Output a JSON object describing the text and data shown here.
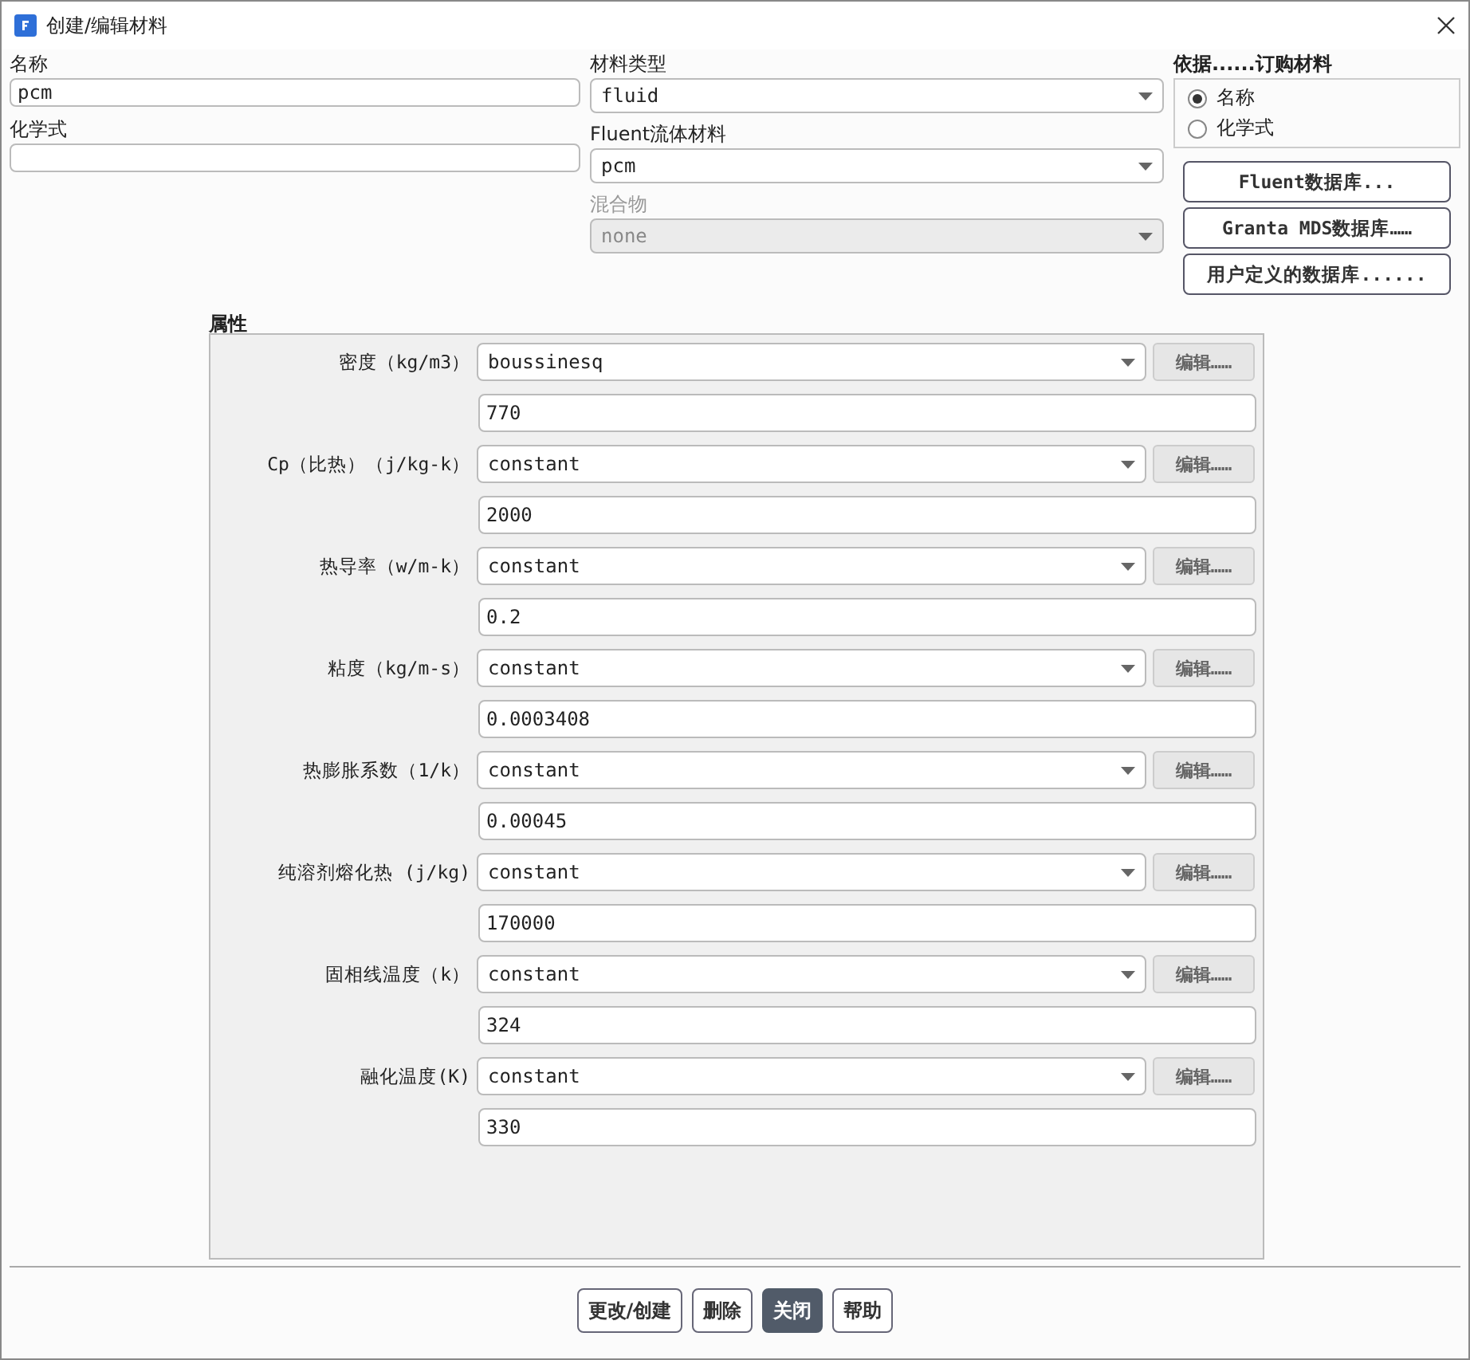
{
  "window": {
    "title": "创建/编辑材料"
  },
  "name": {
    "label": "名称",
    "value": "pcm"
  },
  "formula": {
    "label": "化学式"
  },
  "material_type": {
    "label": "材料类型",
    "value": "fluid",
    "disabled": false
  },
  "fluent_material": {
    "label": "Fluent流体材料",
    "value": "pcm",
    "disabled": false
  },
  "mixture": {
    "label": "混合物",
    "value": "none",
    "disabled": true
  },
  "order_by": {
    "label": "依据......订购材料",
    "options": [
      {
        "label": "名称",
        "selected": true
      },
      {
        "label": "化学式",
        "selected": false
      }
    ]
  },
  "database_buttons": [
    "Fluent数据库...",
    "Granta MDS数据库……",
    "用户定义的数据库......"
  ],
  "properties": {
    "title": "属性",
    "rows": [
      {
        "label": "密度（kg/m3）",
        "method": "boussinesq",
        "value": "770",
        "edit": "编辑……",
        "edit_disabled": true
      },
      {
        "label": "Cp（比热）（j/kg-k）",
        "method": "constant",
        "value": "2000",
        "edit": "编辑……",
        "edit_disabled": true
      },
      {
        "label": "热导率（w/m-k）",
        "method": "constant",
        "value": "0.2",
        "edit": "编辑……",
        "edit_disabled": true
      },
      {
        "label": "粘度（kg/m-s）",
        "method": "constant",
        "value": "0.0003408",
        "edit": "编辑……",
        "edit_disabled": true
      },
      {
        "label": "热膨胀系数（1/k）",
        "method": "constant",
        "value": "0.00045",
        "edit": "编辑……",
        "edit_disabled": true
      },
      {
        "label": "纯溶剂熔化热 (j/kg)",
        "method": "constant",
        "value": "170000",
        "edit": "编辑……",
        "edit_disabled": true
      },
      {
        "label": "固相线温度（k）",
        "method": "constant",
        "value": "324",
        "edit": "编辑……",
        "edit_disabled": true
      },
      {
        "label": "融化温度(K)",
        "method": "constant",
        "value": "330",
        "edit": "编辑……",
        "edit_disabled": true
      }
    ]
  },
  "footer_buttons": [
    {
      "label": "更改/创建",
      "default": false
    },
    {
      "label": "删除",
      "default": false
    },
    {
      "label": "关闭",
      "default": true
    },
    {
      "label": "帮助",
      "default": false
    }
  ]
}
